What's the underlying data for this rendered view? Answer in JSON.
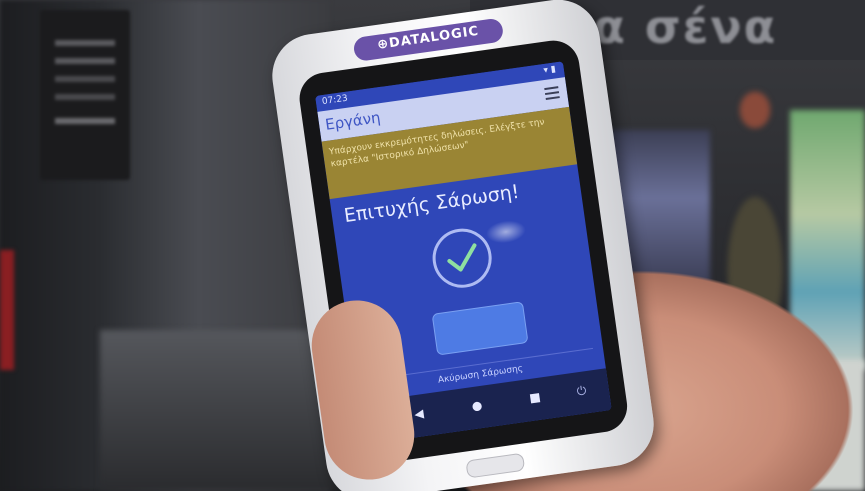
{
  "background": {
    "sign_text": "για σένα"
  },
  "device": {
    "brand_logo": "⊕DATALOGIC"
  },
  "screen": {
    "status_time": "07:23",
    "status_icons": "▾ ▮",
    "app_name": "Εργάνη",
    "notice_text": "Υπάρχουν εκκρεμότητες δηλώσεις. Ελέγξτε την καρτέλα \"Ιστορικό Δηλώσεων\"",
    "heading": "Επιτυχής Σάρωση!",
    "cancel_label": "Ακύρωση Σάρωσης",
    "nav_back": "◀",
    "nav_home": "●",
    "nav_recent": "■",
    "nav_power": "⏻"
  },
  "colors": {
    "screen_blue": "#2f47b8",
    "notice_gold": "#9a8534",
    "brand_purple": "#6a52a8"
  }
}
